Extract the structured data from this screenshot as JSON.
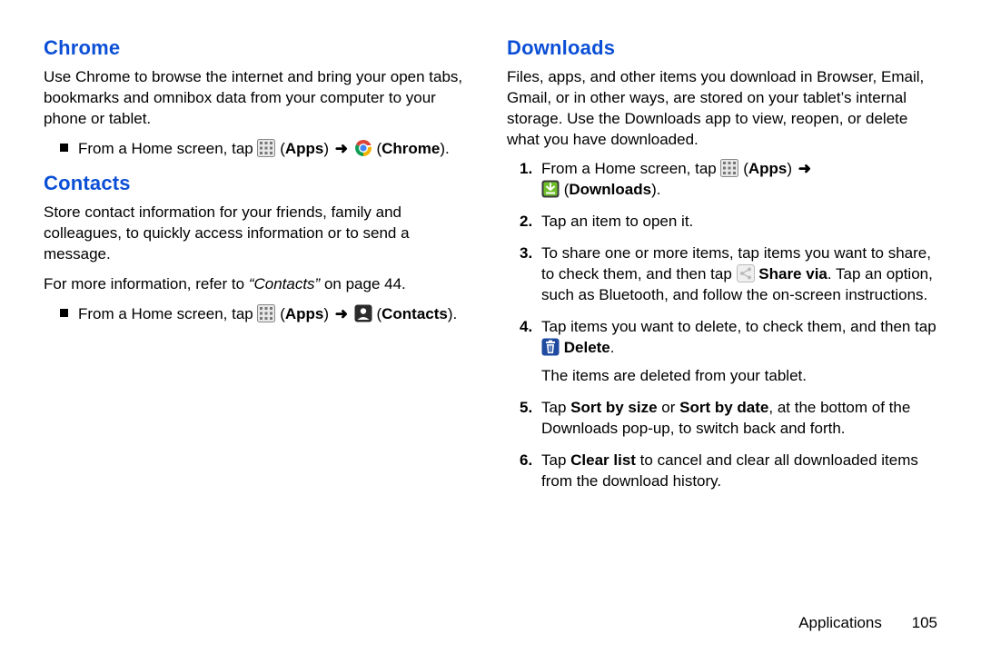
{
  "left": {
    "chrome": {
      "heading": "Chrome",
      "desc": "Use Chrome to browse the internet and bring your open tabs, bookmarks and omnibox data from your computer to your phone or tablet.",
      "bullet_prefix": "From a Home screen, tap ",
      "apps_label": "Apps",
      "chrome_label": "Chrome"
    },
    "contacts": {
      "heading": "Contacts",
      "desc": "Store contact information for your friends, family and colleagues, to quickly access information or to send a message.",
      "ref_pre": "For more information, refer to ",
      "ref_ital": "“Contacts”",
      "ref_post": " on page 44.",
      "bullet_prefix": "From a Home screen, tap ",
      "apps_label": "Apps",
      "contacts_label": "Contacts"
    }
  },
  "right": {
    "downloads": {
      "heading": "Downloads",
      "desc": "Files, apps, and other items you download in Browser, Email, Gmail, or in other ways, are stored on your tablet’s internal storage. Use the Downloads app to view, reopen, or delete what you have downloaded.",
      "step1_prefix": "From a Home screen, tap ",
      "step1_apps": "Apps",
      "step1_dl_label": "Downloads",
      "step2": "Tap an item to open it.",
      "step3_a": "To share one or more items, tap items you want to share, to check them, and then tap ",
      "step3_share": "Share via",
      "step3_b": ". Tap an option, such as Bluetooth, and follow the on-screen instructions.",
      "step4_a": "Tap items you want to delete, to check them, and then tap ",
      "step4_delete": "Delete",
      "step4_note": "The items are deleted from your tablet.",
      "step5_a": "Tap ",
      "step5_sort1": "Sort by size",
      "step5_or": " or ",
      "step5_sort2": "Sort by date",
      "step5_b": ", at the bottom of the Downloads pop-up, to switch back and forth.",
      "step6_a": "Tap ",
      "step6_clear": "Clear list",
      "step6_b": " to cancel and clear all downloaded items from the download history."
    }
  },
  "footer": {
    "section": "Applications",
    "page": "105"
  },
  "arrow": "➜"
}
